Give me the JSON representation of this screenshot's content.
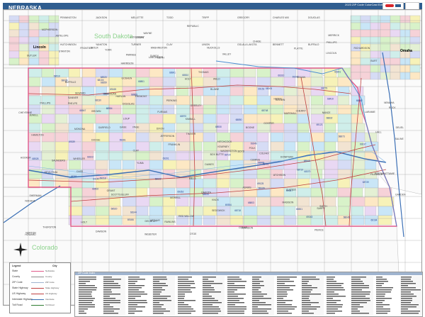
{
  "header": {
    "title": "NEBRASKA",
    "edition": "2023 ZIP Code ColorCast Edition"
  },
  "map": {
    "region_labels": {
      "south_dakota": "South Dakota",
      "colorado": "Colorado",
      "kansas": "Kansas",
      "iowa": "Iowa"
    },
    "cities": {
      "lincoln": "Lincoln",
      "omaha": "Omaha"
    },
    "county_labels": [
      "PENNINGTON",
      "JACKSON",
      "MELLETTE",
      "TODD",
      "TRIPP",
      "GREGORY",
      "CHARLES MIX",
      "DOUGLAS",
      "HUTCHINSON",
      "YANKTON",
      "TURNER",
      "CLAY",
      "UNION",
      "OGLALA LAKOTA",
      "BENNETT",
      "BUFFALO",
      "MONONA",
      "HARRISON",
      "POTTAWATTAMIE",
      "MILLS",
      "FREMONT",
      "PAGE",
      "WOODBURY",
      "ATCHISON",
      "HOLT",
      "NODAHA",
      "DONIPHAN",
      "BROWN",
      "NEMAHA",
      "MARSHALL",
      "WASHINGTON",
      "REPUBLIC",
      "JEWELL",
      "SMITH",
      "PHILLIPS",
      "NORTON",
      "DECATUR",
      "RAWLINS",
      "CHEYENNE",
      "YUMA",
      "SEDGWICK",
      "LOGAN",
      "PHILLIPS",
      "WELD",
      "GOSHEN",
      "LARAMIE",
      "CHERRY",
      "SHERIDAN",
      "SIOUX",
      "DAWES",
      "BOX BUTTE",
      "SCOTTS BLUFF",
      "BANNER",
      "KIMBALL",
      "MORRILL",
      "GARDEN",
      "KEITH",
      "DEUEL",
      "PERKINS",
      "CHASE",
      "DUNDY",
      "HAYES",
      "HITCHCOCK",
      "LINCOLN",
      "FRONTIER",
      "RED WILLOW",
      "CUSTER",
      "DAWSON",
      "GOSPER",
      "FURNAS",
      "BUFFALO",
      "KEARNEY",
      "PHELPS",
      "HARLAN",
      "FRANKLIN",
      "WEBSTER",
      "HALL",
      "ADAMS",
      "CLAY",
      "NUCKOLLS",
      "THAYER",
      "JEFFERSON",
      "GAGE",
      "PAWNEE",
      "RICHARDSON",
      "JOHNSON",
      "OTOE",
      "CASS",
      "SARPY",
      "DOUGLAS",
      "WASHINGTON",
      "DODGE",
      "SAUNDERS",
      "LANCASTER",
      "SEWARD",
      "YORK",
      "FILLMORE",
      "SALINE",
      "BUTLER",
      "POLK",
      "HAMILTON",
      "MERRICK",
      "PLATTE",
      "COLFAX",
      "BURT",
      "CUMING",
      "STANTON",
      "MADISON",
      "BOONE",
      "NANCE",
      "GREELEY",
      "HOWARD",
      "SHERMAN",
      "VALLEY",
      "GARFIELD",
      "WHEELER",
      "LOUP",
      "BLAINE",
      "THOMAS",
      "HOOKER",
      "GRANT",
      "ARTHUR",
      "MCPHERSON",
      "LOGAN",
      "ANTELOPE",
      "PIERCE",
      "WAYNE",
      "THURSTON",
      "DAKOTA",
      "DIXON",
      "CEDAR",
      "KNOX",
      "HOLT",
      "ROCK",
      "BROWN",
      "KEYA PAHA",
      "BOYD"
    ],
    "zip_labels": [
      "69201",
      "69218",
      "69337",
      "69339",
      "69343",
      "69346",
      "69347",
      "69352",
      "69354",
      "69361",
      "69120",
      "69121",
      "69125",
      "69140",
      "69145",
      "69153",
      "69165",
      "69166",
      "68701",
      "68710",
      "68718",
      "68729",
      "68739",
      "68748",
      "68761",
      "68779",
      "68801",
      "68803",
      "68810",
      "68832",
      "68845",
      "68847",
      "68850",
      "68862",
      "68869",
      "68873",
      "68901",
      "68920",
      "68930",
      "68954",
      "68970",
      "68978",
      "68005",
      "68022",
      "68028",
      "68046",
      "68102",
      "68104",
      "68114",
      "68130",
      "68144",
      "68164",
      "68301",
      "68310",
      "68333",
      "68359",
      "68370",
      "68401",
      "68410",
      "68502",
      "68510",
      "68520",
      "68528"
    ]
  },
  "legend": {
    "title": "Legend",
    "rows": [
      {
        "label": "State",
        "value": "Nebraska"
      },
      {
        "label": "County",
        "value": "County"
      },
      {
        "label": "ZIP Code",
        "value": "ZIP Code"
      },
      {
        "label": "State Highway",
        "value": "State Highway"
      },
      {
        "label": "US Highway",
        "value": "US Highway"
      },
      {
        "label": "Interstate Highway",
        "value": "Interstate"
      },
      {
        "label": "Toll Road",
        "value": "Toll Road"
      }
    ],
    "city_key": "City"
  },
  "index": {
    "title": "ZIP Code Index"
  },
  "colors": {
    "title_bar": "#2f5d8f",
    "state_border": "#e05a8a",
    "county_line": "#8c8c8c",
    "highway": "#c04040",
    "interstate": "#3b6fb5",
    "fills": [
      "#c9e6f7",
      "#f6d2d8",
      "#d8f2c9",
      "#e9d8f3",
      "#fde8c4",
      "#cfeeea",
      "#f2e4d2",
      "#d6dcf5",
      "#f7f2b8",
      "#e4f0d4"
    ]
  }
}
